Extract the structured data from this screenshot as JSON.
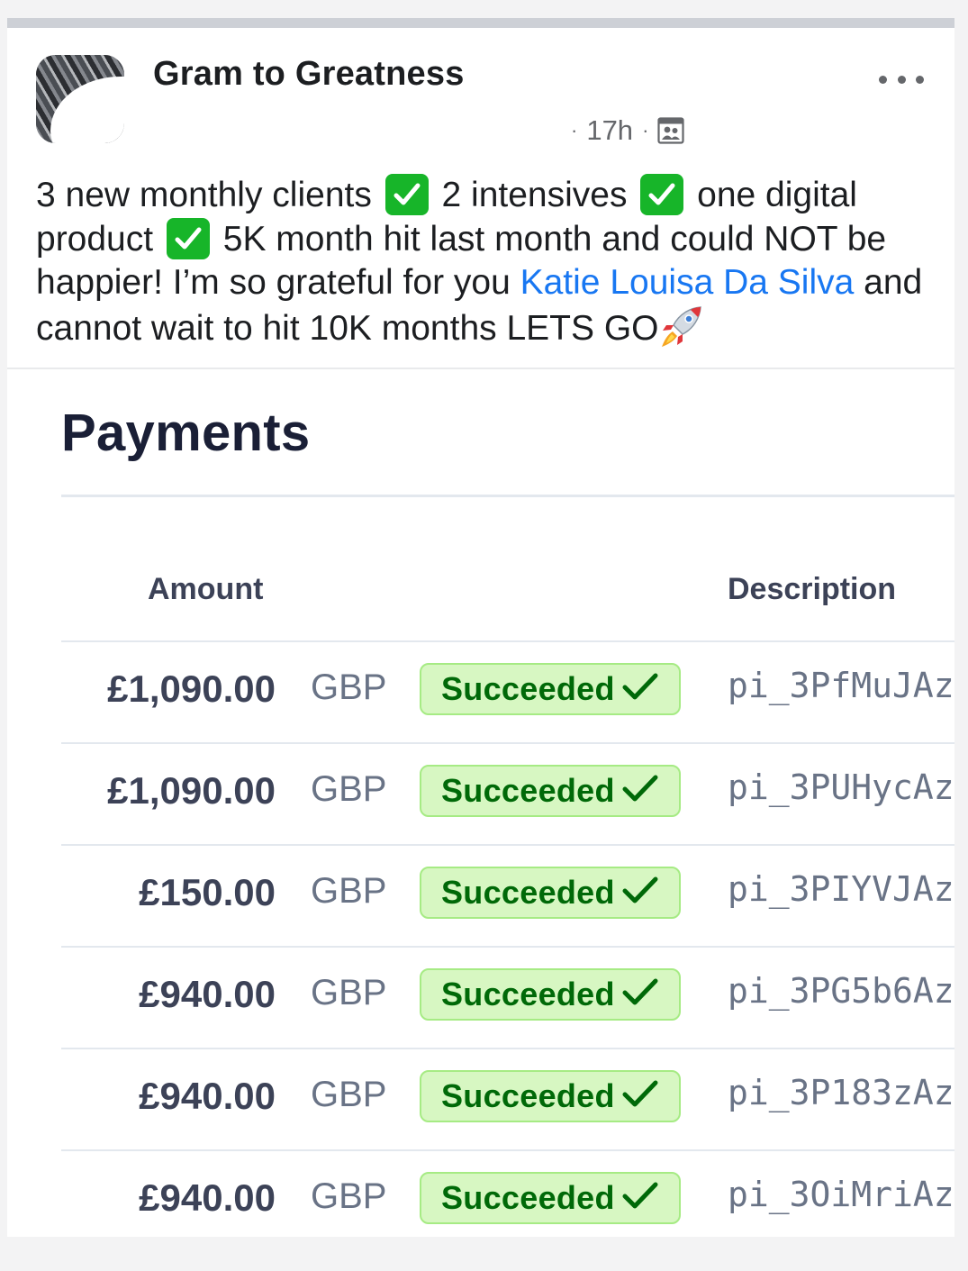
{
  "post": {
    "page_name": "Gram to Greatness",
    "time": "17h",
    "separator": "·",
    "audience_icon": "group-audience-icon",
    "more_icon": "more-options-icon",
    "text": {
      "seg1": "3 new monthly clients ",
      "seg2": " 2 intensives ",
      "seg3": " one digital product ",
      "seg4": " 5K month hit last month and could NOT be happier! I’m so grateful for you ",
      "mention": "Katie Louisa Da Silva",
      "seg5": " and cannot wait to hit 10K months LETS GO"
    },
    "emoji": {
      "check": "check-mark-button-emoji",
      "rocket": "rocket-emoji"
    }
  },
  "payments": {
    "title": "Payments",
    "columns": {
      "amount": "Amount",
      "description": "Description"
    },
    "status_color": "#006908",
    "rows": [
      {
        "amount": "£1,090.00",
        "currency": "GBP",
        "status": "Succeeded",
        "description": "pi_3PfMuJAz"
      },
      {
        "amount": "£1,090.00",
        "currency": "GBP",
        "status": "Succeeded",
        "description": "pi_3PUHycAz"
      },
      {
        "amount": "£150.00",
        "currency": "GBP",
        "status": "Succeeded",
        "description": "pi_3PIYVJAz"
      },
      {
        "amount": "£940.00",
        "currency": "GBP",
        "status": "Succeeded",
        "description": "pi_3PG5b6Az"
      },
      {
        "amount": "£940.00",
        "currency": "GBP",
        "status": "Succeeded",
        "description": "pi_3P183zAz"
      },
      {
        "amount": "£940.00",
        "currency": "GBP",
        "status": "Succeeded",
        "description": "pi_3OiMriAz"
      }
    ]
  }
}
